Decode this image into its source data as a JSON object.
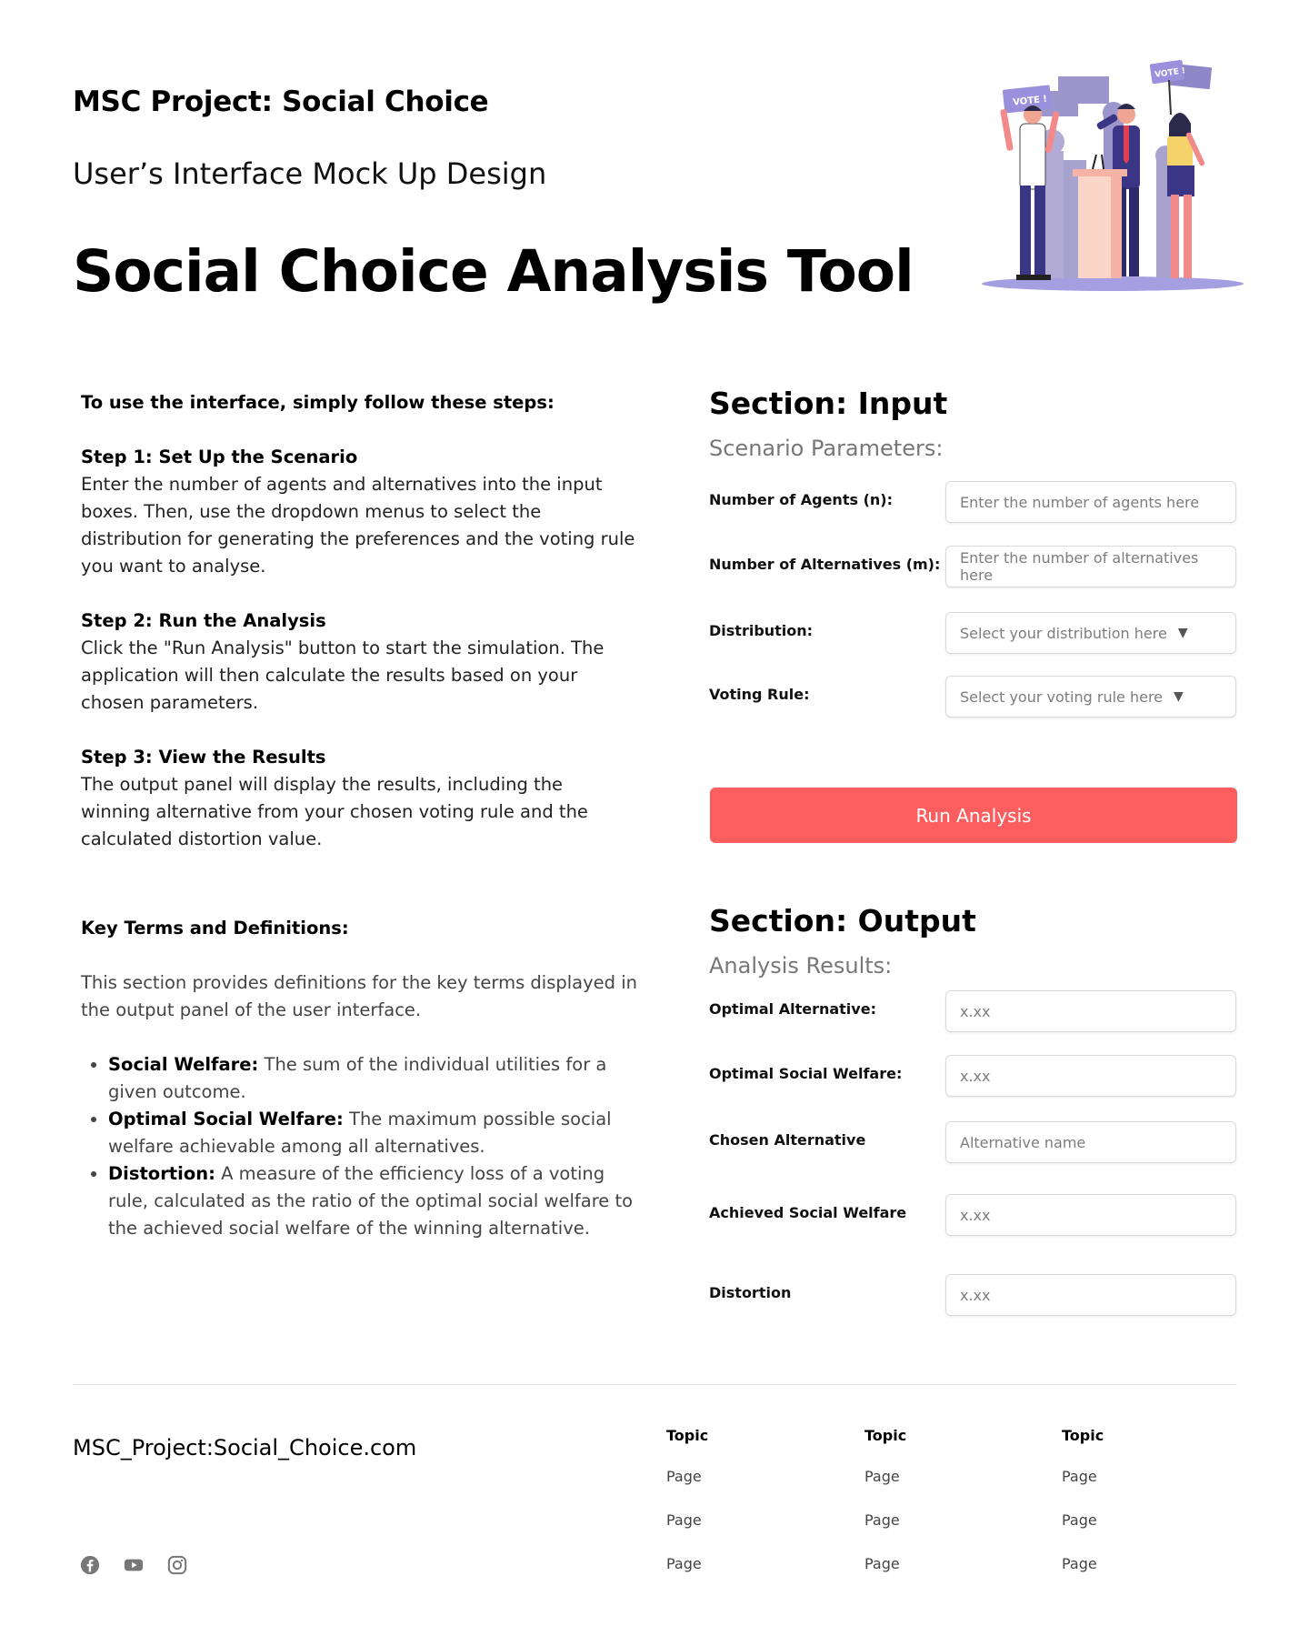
{
  "header": {
    "project_title": "MSC Project: Social Choice",
    "subtitle": "User’s Interface Mock Up Design",
    "main_title": "Social Choice Analysis Tool",
    "hero_signs": [
      "VOTE !",
      "VOTE !"
    ]
  },
  "instructions": {
    "intro": "To use the interface, simply follow these steps:",
    "steps": [
      {
        "title": "Step 1: Set Up the Scenario",
        "body": "Enter the number of agents and alternatives into the input boxes. Then, use the dropdown menus to select the distribution for generating the preferences and the voting rule you want to analyse."
      },
      {
        "title": "Step 2: Run the Analysis",
        "body": "Click the \"Run Analysis\" button to start the simulation. The application will then calculate the results based on your chosen parameters."
      },
      {
        "title": "Step 3: View the Results",
        "body": "The output panel will display the results, including the winning alternative from your chosen voting rule and the calculated distortion value."
      }
    ]
  },
  "key_terms": {
    "title": "Key Terms and Definitions:",
    "intro": "This section provides definitions for the key terms displayed in the output panel of the user interface.",
    "items": [
      {
        "term": "Social Welfare:",
        "definition": " The sum of the individual utilities for a given outcome."
      },
      {
        "term": "Optimal Social Welfare:",
        "definition": " The maximum possible social welfare achievable among all alternatives."
      },
      {
        "term": "Distortion:",
        "definition": " A measure of the efficiency loss of a voting rule, calculated as the ratio of the optimal social welfare to the achieved social welfare of the winning alternative."
      }
    ]
  },
  "input_section": {
    "title": "Section: Input",
    "subtitle": "Scenario Parameters:",
    "fields": [
      {
        "label": "Number of Agents (n):",
        "placeholder": "Enter the number of agents here"
      },
      {
        "label": "Number of Alternatives (m):",
        "placeholder": "Enter the number of alternatives here"
      },
      {
        "label": "Distribution:",
        "placeholder": "Select your distribution here",
        "caret": "▼"
      },
      {
        "label": "Voting Rule:",
        "placeholder": "Select your voting rule here",
        "caret": "▼"
      }
    ],
    "run_button": "Run Analysis",
    "button_color": "#fc5e5f"
  },
  "output_section": {
    "title": "Section: Output",
    "subtitle": "Analysis Results:",
    "fields": [
      {
        "label": "Optimal Alternative:",
        "value": "x.xx"
      },
      {
        "label": "Optimal Social Welfare:",
        "value": "x.xx"
      },
      {
        "label": "Chosen Alternative",
        "value": "Alternative name"
      },
      {
        "label": "Achieved Social Welfare",
        "value": "x.xx"
      },
      {
        "label": "Distortion",
        "value": "x.xx"
      }
    ]
  },
  "footer": {
    "site": "MSC_Project:Social_Choice.com",
    "social_icons": [
      "facebook-icon",
      "youtube-icon",
      "instagram-icon"
    ],
    "columns": [
      {
        "title": "Topic",
        "links": [
          "Page",
          "Page",
          "Page"
        ]
      },
      {
        "title": "Topic",
        "links": [
          "Page",
          "Page",
          "Page"
        ]
      },
      {
        "title": "Topic",
        "links": [
          "Page",
          "Page",
          "Page"
        ]
      }
    ]
  }
}
